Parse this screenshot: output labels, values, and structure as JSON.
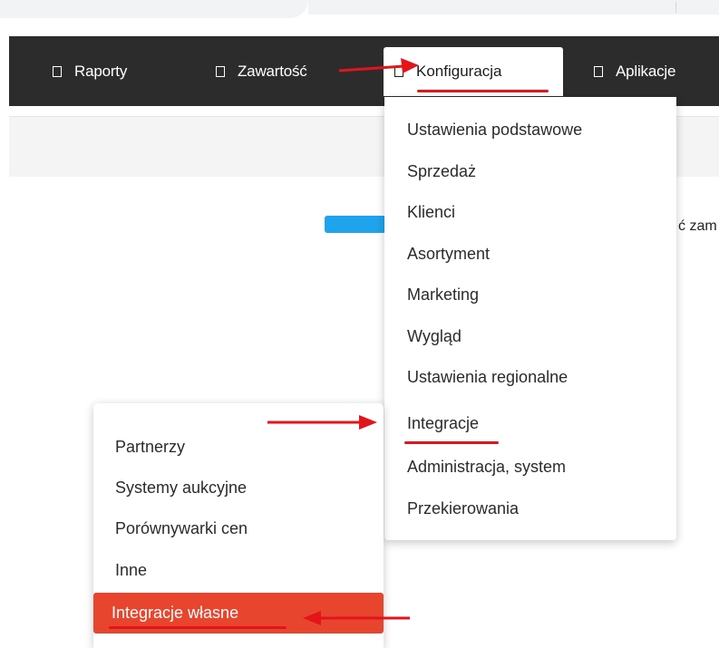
{
  "nav": {
    "items": [
      {
        "label": "Raporty",
        "icon": "square-icon"
      },
      {
        "label": "Zawartość",
        "icon": "square-icon"
      },
      {
        "label": "Konfiguracja",
        "icon": "square-icon"
      },
      {
        "label": "Aplikacje",
        "icon": "square-icon"
      }
    ]
  },
  "dropdown": {
    "items": [
      "Ustawienia podstawowe",
      "Sprzedaż",
      "Klienci",
      "Asortyment",
      "Marketing",
      "Wygląd",
      "Ustawienia regionalne",
      "Integracje",
      "Administracja, system",
      "Przekierowania"
    ]
  },
  "submenu": {
    "items": [
      "Partnerzy",
      "Systemy aukcyjne",
      "Porównywarki cen",
      "Inne",
      "Integracje własne"
    ]
  },
  "page": {
    "partial_text": "ć zam"
  },
  "colors": {
    "navbar": "#2c2c2c",
    "accent_red": "#e3141a",
    "active_item": "#e8452e",
    "blue_button": "#1fa3ec"
  }
}
